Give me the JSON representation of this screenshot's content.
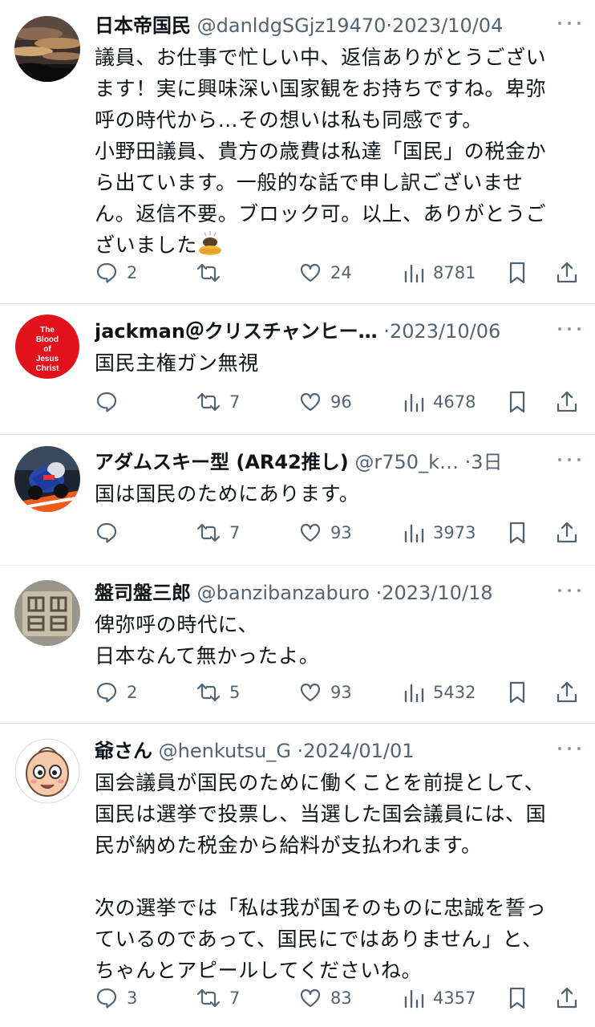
{
  "tweets": [
    {
      "name": "日本帝国民",
      "handle": "@danldgSGjz19470",
      "date": "2023/10/04",
      "lines": [
        "議員、お仕事で忙しい中、返信ありがとうござい",
        "ます！実に興味深い国家観をお持ちですね。卑弥",
        "呼の時代から…その想いは私も同感です。",
        "小野田議員、貴方の歳費は私達「国民」の税金か",
        "ら出ています。一般的な話で申し訳ございませ",
        "ん。返信不要。ブロック可。以上、ありがとうご",
        "ざいました"
      ],
      "replies": "2",
      "retweets": "",
      "likes": "24",
      "views": "8781",
      "avatar": "sunset-clouds"
    },
    {
      "name": "jackman＠クリスチャンヒー…",
      "handle": "",
      "date": "2023/10/06",
      "lines": [
        "国民主権ガン無視"
      ],
      "replies": "",
      "retweets": "7",
      "likes": "96",
      "views": "4678",
      "avatar": "red-circle",
      "avatar_text": [
        "The",
        "Blood",
        "of",
        "Jesus",
        "Christ"
      ]
    },
    {
      "name": "アダムスキー型 (AR42推し)",
      "handle": "@r750_k…",
      "date": "3日",
      "lines": [
        "国は国民のためにあります。"
      ],
      "replies": "",
      "retweets": "7",
      "likes": "93",
      "views": "3973",
      "avatar": "motorcycle-racer"
    },
    {
      "name": "盤司盤三郎",
      "handle": "@banzibanzaburo",
      "date": "2023/10/18",
      "lines": [
        "俾弥呼の時代に、",
        "日本なんて無かったよ。"
      ],
      "replies": "2",
      "retweets": "5",
      "likes": "93",
      "views": "5432",
      "avatar": "stone-seal"
    },
    {
      "name": "爺さん",
      "handle": "@henkutsu_G",
      "date": "2024/01/01",
      "lines": [
        "国会議員が国民のために働くことを前提として、",
        "国民は選挙で投票し、当選した国会議員には、国",
        "民が納めた税金から給料が支払われます。",
        "",
        "次の選挙では「私は我が国そのものに忠誠を誓っ",
        "ているのであって、国民にではありません」と、",
        "ちゃんとアピールしてくださいね。"
      ],
      "replies": "3",
      "retweets": "7",
      "likes": "83",
      "views": "4357",
      "avatar": "cartoon-baby"
    }
  ],
  "colors": {
    "text": "#0f1419",
    "muted": "#536471",
    "divider": "#e6e9ec"
  }
}
